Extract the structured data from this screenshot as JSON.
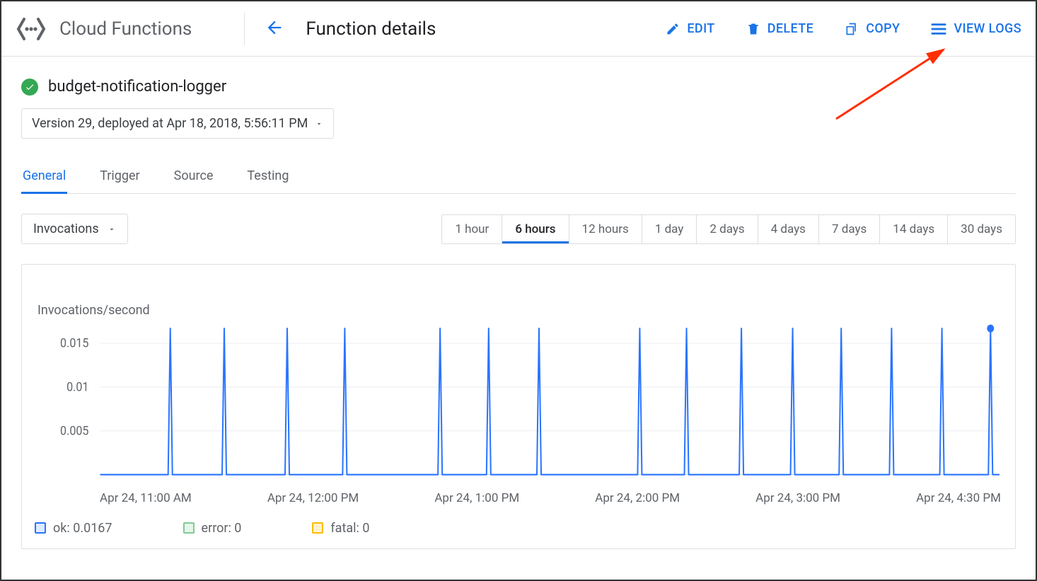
{
  "header": {
    "product": "Cloud Functions",
    "page_title": "Function details",
    "actions": {
      "edit": "EDIT",
      "delete": "DELETE",
      "copy": "COPY",
      "view_logs": "VIEW LOGS"
    }
  },
  "function": {
    "name": "budget-notification-logger",
    "version_text": "Version 29, deployed at Apr 18, 2018, 5:56:11 PM"
  },
  "tabs": [
    "General",
    "Trigger",
    "Source",
    "Testing"
  ],
  "active_tab": "General",
  "metric_select": "Invocations",
  "time_ranges": [
    "1 hour",
    "6 hours",
    "12 hours",
    "1 day",
    "2 days",
    "4 days",
    "7 days",
    "14 days",
    "30 days"
  ],
  "active_range": "6 hours",
  "chart_data": {
    "type": "line",
    "title": "Invocations/second",
    "ylabel": "Invocations/second",
    "xlabel": "",
    "ylim": [
      0,
      0.017
    ],
    "yticks": [
      0.005,
      0.01,
      0.015
    ],
    "x_tick_labels": [
      "Apr 24, 11:00 AM",
      "Apr 24, 12:00 PM",
      "Apr 24, 1:00 PM",
      "Apr 24, 2:00 PM",
      "Apr 24, 3:00 PM",
      "Apr 24, 4:30 PM"
    ],
    "spike_height": 0.0167,
    "spike_x_positions": [
      0.078,
      0.138,
      0.208,
      0.272,
      0.378,
      0.432,
      0.488,
      0.6,
      0.652,
      0.713,
      0.77,
      0.824,
      0.88,
      0.936,
      0.99
    ],
    "marker_last": true,
    "series": [
      {
        "name": "ok",
        "value_label": "0.0167",
        "color": "#2a74ff"
      },
      {
        "name": "error",
        "value_label": "0",
        "color": "#81c995"
      },
      {
        "name": "fatal",
        "value_label": "0",
        "color": "#fbbc04"
      }
    ]
  },
  "legend": {
    "ok": "ok: 0.0167",
    "error": "error: 0",
    "fatal": "fatal: 0"
  }
}
